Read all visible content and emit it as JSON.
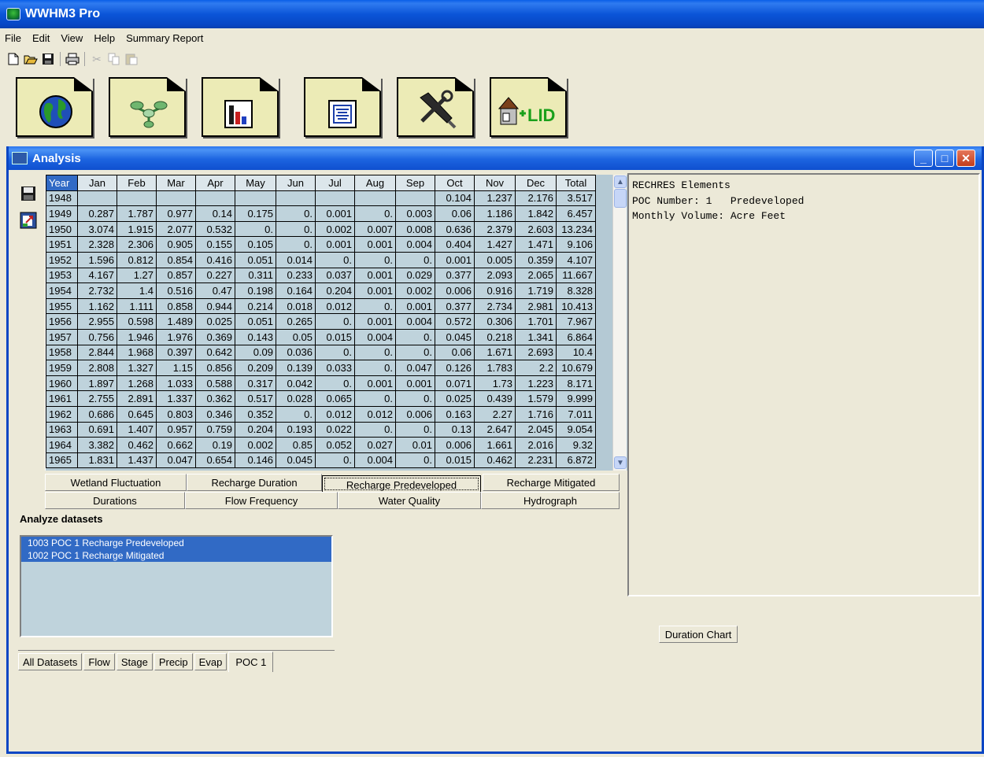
{
  "app": {
    "title": "WWHM3 Pro"
  },
  "menu": [
    "File",
    "Edit",
    "View",
    "Help",
    "Summary Report"
  ],
  "toolbar": [
    "new-icon",
    "open-icon",
    "save-icon",
    "print-icon",
    "cut-icon",
    "copy-icon",
    "paste-icon"
  ],
  "big_tools": [
    {
      "name": "map-globe-tool",
      "icon": "globe-icon"
    },
    {
      "name": "schematic-tool",
      "icon": "network-icon"
    },
    {
      "name": "analysis-tool",
      "icon": "bar-chart-icon"
    },
    {
      "name": "report-tool",
      "icon": "document-icon"
    },
    {
      "name": "tools-tool",
      "icon": "tools-icon"
    },
    {
      "name": "lid-tool",
      "icon": "lid-icon",
      "label": "LID"
    }
  ],
  "window": {
    "title": "Analysis",
    "minimize": "_",
    "maximize": "□",
    "close": "✕"
  },
  "table": {
    "columns": [
      "Year",
      "Jan",
      "Feb",
      "Mar",
      "Apr",
      "May",
      "Jun",
      "Jul",
      "Aug",
      "Sep",
      "Oct",
      "Nov",
      "Dec",
      "Total"
    ],
    "rows": [
      [
        "1948",
        "",
        "",
        "",
        "",
        "",
        "",
        "",
        "",
        "",
        "0.104",
        "1.237",
        "2.176",
        "3.517"
      ],
      [
        "1949",
        "0.287",
        "1.787",
        "0.977",
        "0.14",
        "0.175",
        "0.",
        "0.001",
        "0.",
        "0.003",
        "0.06",
        "1.186",
        "1.842",
        "6.457"
      ],
      [
        "1950",
        "3.074",
        "1.915",
        "2.077",
        "0.532",
        "0.",
        "0.",
        "0.002",
        "0.007",
        "0.008",
        "0.636",
        "2.379",
        "2.603",
        "13.234"
      ],
      [
        "1951",
        "2.328",
        "2.306",
        "0.905",
        "0.155",
        "0.105",
        "0.",
        "0.001",
        "0.001",
        "0.004",
        "0.404",
        "1.427",
        "1.471",
        "9.106"
      ],
      [
        "1952",
        "1.596",
        "0.812",
        "0.854",
        "0.416",
        "0.051",
        "0.014",
        "0.",
        "0.",
        "0.",
        "0.001",
        "0.005",
        "0.359",
        "4.107"
      ],
      [
        "1953",
        "4.167",
        "1.27",
        "0.857",
        "0.227",
        "0.311",
        "0.233",
        "0.037",
        "0.001",
        "0.029",
        "0.377",
        "2.093",
        "2.065",
        "11.667"
      ],
      [
        "1954",
        "2.732",
        "1.4",
        "0.516",
        "0.47",
        "0.198",
        "0.164",
        "0.204",
        "0.001",
        "0.002",
        "0.006",
        "0.916",
        "1.719",
        "8.328"
      ],
      [
        "1955",
        "1.162",
        "1.111",
        "0.858",
        "0.944",
        "0.214",
        "0.018",
        "0.012",
        "0.",
        "0.001",
        "0.377",
        "2.734",
        "2.981",
        "10.413"
      ],
      [
        "1956",
        "2.955",
        "0.598",
        "1.489",
        "0.025",
        "0.051",
        "0.265",
        "0.",
        "0.001",
        "0.004",
        "0.572",
        "0.306",
        "1.701",
        "7.967"
      ],
      [
        "1957",
        "0.756",
        "1.946",
        "1.976",
        "0.369",
        "0.143",
        "0.05",
        "0.015",
        "0.004",
        "0.",
        "0.045",
        "0.218",
        "1.341",
        "6.864"
      ],
      [
        "1958",
        "2.844",
        "1.968",
        "0.397",
        "0.642",
        "0.09",
        "0.036",
        "0.",
        "0.",
        "0.",
        "0.06",
        "1.671",
        "2.693",
        "10.4"
      ],
      [
        "1959",
        "2.808",
        "1.327",
        "1.15",
        "0.856",
        "0.209",
        "0.139",
        "0.033",
        "0.",
        "0.047",
        "0.126",
        "1.783",
        "2.2",
        "10.679"
      ],
      [
        "1960",
        "1.897",
        "1.268",
        "1.033",
        "0.588",
        "0.317",
        "0.042",
        "0.",
        "0.001",
        "0.001",
        "0.071",
        "1.73",
        "1.223",
        "8.171"
      ],
      [
        "1961",
        "2.755",
        "2.891",
        "1.337",
        "0.362",
        "0.517",
        "0.028",
        "0.065",
        "0.",
        "0.",
        "0.025",
        "0.439",
        "1.579",
        "9.999"
      ],
      [
        "1962",
        "0.686",
        "0.645",
        "0.803",
        "0.346",
        "0.352",
        "0.",
        "0.012",
        "0.012",
        "0.006",
        "0.163",
        "2.27",
        "1.716",
        "7.011"
      ],
      [
        "1963",
        "0.691",
        "1.407",
        "0.957",
        "0.759",
        "0.204",
        "0.193",
        "0.022",
        "0.",
        "0.",
        "0.13",
        "2.647",
        "2.045",
        "9.054"
      ],
      [
        "1964",
        "3.382",
        "0.462",
        "0.662",
        "0.19",
        "0.002",
        "0.85",
        "0.052",
        "0.027",
        "0.01",
        "0.006",
        "1.661",
        "2.016",
        "9.32"
      ],
      [
        "1965",
        "1.831",
        "1.437",
        "0.047",
        "0.654",
        "0.146",
        "0.045",
        "0.",
        "0.004",
        "0.",
        "0.015",
        "0.462",
        "2.231",
        "6.872"
      ]
    ]
  },
  "analysis_buttons": {
    "row1": [
      "Wetland Fluctuation",
      "Recharge Duration",
      "Recharge Predeveloped",
      "Recharge Mitigated"
    ],
    "row2": [
      "Durations",
      "Flow Frequency",
      "Water Quality",
      "Hydrograph"
    ]
  },
  "analyze": {
    "label": "Analyze datasets",
    "items": [
      "1003 POC 1 Recharge Predeveloped",
      "1002 POC 1 Recharge Mitigated"
    ]
  },
  "bottom_tabs": [
    "All Datasets",
    "Flow",
    "Stage",
    "Precip",
    "Evap",
    "POC 1"
  ],
  "info": {
    "line1": "RECHRES Elements",
    "line2": "POC Number: 1   Predeveloped",
    "line3": "Monthly Volume: Acre Feet"
  },
  "duration_chart": "Duration Chart"
}
